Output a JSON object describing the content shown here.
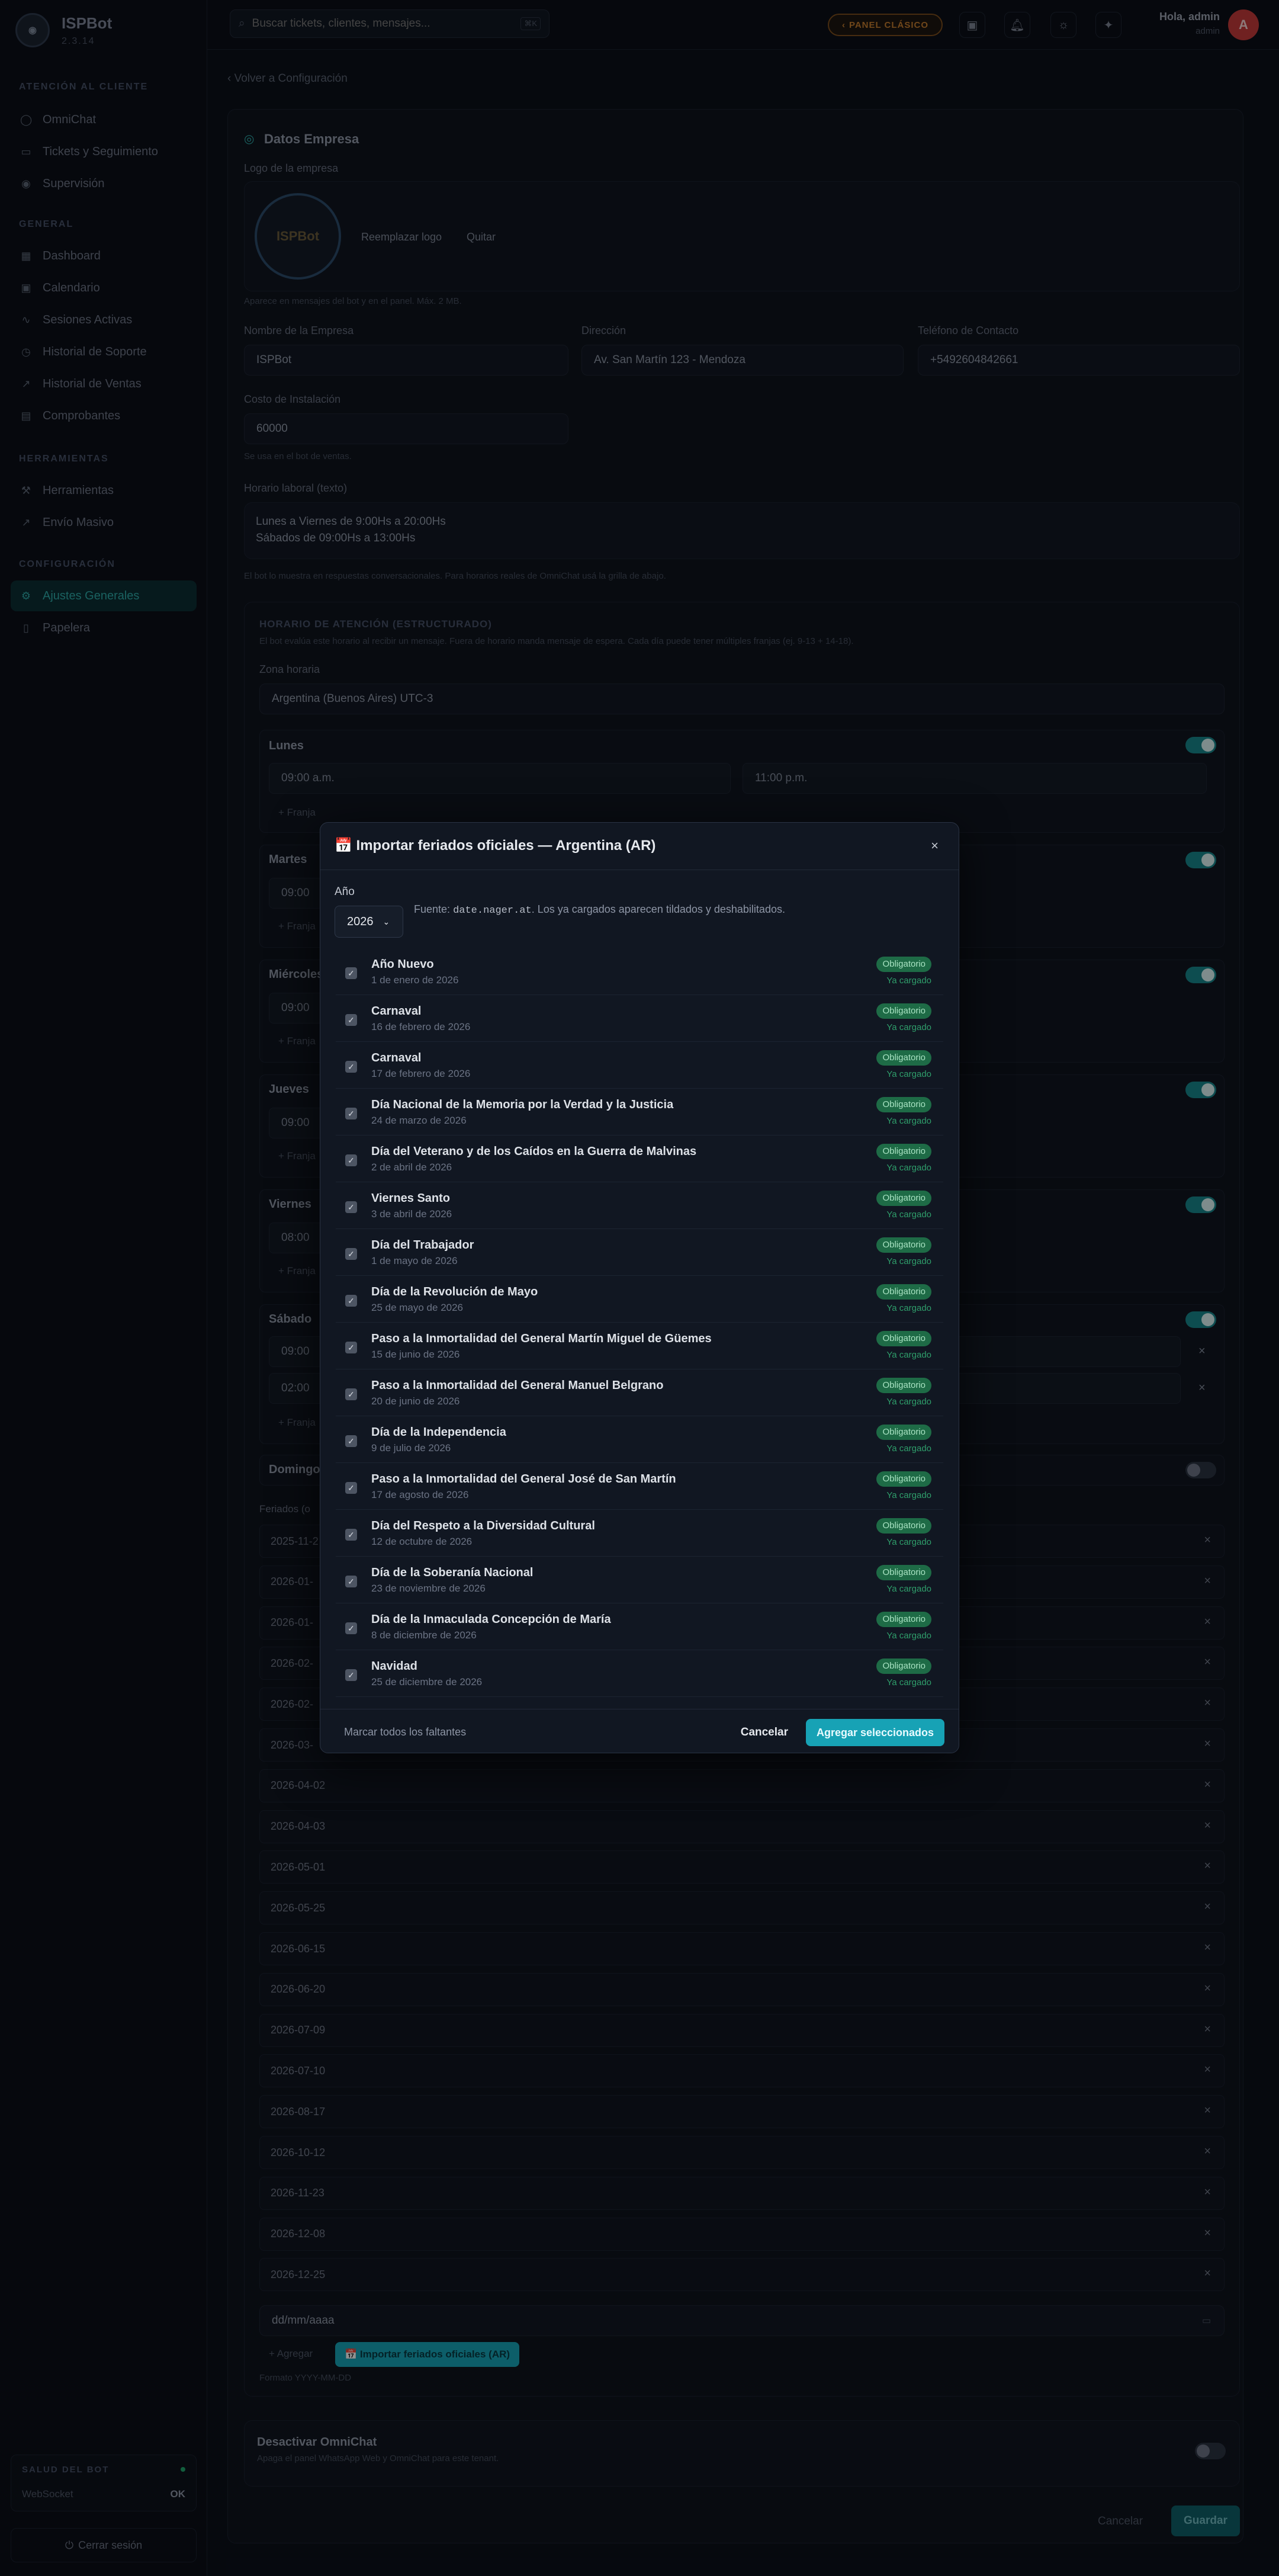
{
  "app": {
    "name": "ISPBot",
    "version": "2.3.14"
  },
  "sidebar": {
    "sections": [
      {
        "title": "ATENCIÓN AL CLIENTE",
        "items": [
          "OmniChat",
          "Tickets y Seguimiento",
          "Supervisión"
        ]
      },
      {
        "title": "GENERAL",
        "items": [
          "Dashboard",
          "Calendario",
          "Sesiones Activas",
          "Historial de Soporte",
          "Historial de Ventas",
          "Comprobantes"
        ]
      },
      {
        "title": "HERRAMIENTAS",
        "items": [
          "Herramientas",
          "Envío Masivo"
        ]
      },
      {
        "title": "CONFIGURACIÓN",
        "items": [
          "Ajustes Generales",
          "Papelera"
        ]
      }
    ],
    "health": {
      "title": "SALUD DEL BOT",
      "label": "WebSocket",
      "value": "OK"
    },
    "logout": "Cerrar sesión"
  },
  "topbar": {
    "search_placeholder": "Buscar tickets, clientes, mensajes...",
    "search_kbd": "⌘K",
    "panel_button": "PANEL CLÁSICO",
    "user_greeting": "Hola, admin",
    "user_role": "admin",
    "avatar_letter": "A"
  },
  "page": {
    "back": "‹ Volver a Configuración",
    "section_title": "Datos Empresa",
    "logo_label": "Logo de la empresa",
    "logo_text": "ISPBot",
    "replace_logo": "Reemplazar logo",
    "remove_logo": "Quitar",
    "logo_hint": "Aparece en mensajes del bot y en el panel. Máx. 2 MB.",
    "company_label": "Nombre de la Empresa",
    "company_value": "ISPBot",
    "address_label": "Dirección",
    "address_value": "Av. San Martín 123 - Mendoza",
    "phone_label": "Teléfono de Contacto",
    "phone_value": "+5492604842661",
    "install_label": "Costo de Instalación",
    "install_value": "60000",
    "install_hint": "Se usa en el bot de ventas.",
    "hours_label": "Horario laboral (texto)",
    "hours_line1": "Lunes a Viernes de 9:00Hs a 20:00Hs",
    "hours_line2": "Sábados de 09:00Hs a 13:00Hs",
    "hours_hint": "El bot lo muestra en respuestas conversacionales. Para horarios reales de OmniChat usá la grilla de abajo.",
    "structured_title": "HORARIO DE ATENCIÓN (ESTRUCTURADO)",
    "structured_hint": "El bot evalúa este horario al recibir un mensaje. Fuera de horario manda mensaje de espera. Cada día puede tener múltiples franjas (ej. 9-13 + 14-18).",
    "tz_label": "Zona horaria",
    "tz_value": "Argentina (Buenos Aires) UTC-3",
    "days": [
      {
        "name": "Lunes",
        "from": "09:00 a.m.",
        "to": "11:00 p.m."
      },
      {
        "name": "Martes",
        "from": "09:00"
      },
      {
        "name": "Miércoles",
        "from": "09:00"
      },
      {
        "name": "Jueves",
        "from": "09:00"
      },
      {
        "name": "Viernes",
        "from": "08:00"
      },
      {
        "name": "Sábado",
        "from": "09:00",
        "from2": "02:00"
      },
      {
        "name": "Domingo"
      }
    ],
    "add_franja": "+ Franja",
    "holidays_label": "Feriados (o",
    "holidays": [
      "2025-11-2",
      "2026-01-",
      "2026-01-",
      "2026-02-",
      "2026-02-",
      "2026-03-",
      "2026-04-02",
      "2026-04-03",
      "2026-05-01",
      "2026-05-25",
      "2026-06-15",
      "2026-06-20",
      "2026-07-09",
      "2026-07-10",
      "2026-08-17",
      "2026-10-12",
      "2026-11-23",
      "2026-12-08",
      "2026-12-25"
    ],
    "date_placeholder": "dd/mm/aaaa",
    "add_holiday": "+ Agregar",
    "import_button": "📅 Importar feriados oficiales (AR)",
    "format_hint": "Formato YYYY-MM-DD",
    "disable_title": "Desactivar OmniChat",
    "disable_hint": "Apaga el panel WhatsApp Web y OmniChat para este tenant.",
    "cancel": "Cancelar",
    "save": "Guardar"
  },
  "modal": {
    "title": "📅 Importar feriados oficiales — Argentina (AR)",
    "close": "×",
    "year_label": "Año",
    "year_value": "2026",
    "source_prefix": "Fuente:",
    "source_code": "date.nager.at",
    "source_suffix": ". Los ya cargados aparecen tildados y deshabilitados.",
    "badge": "Obligatorio",
    "loaded": "Ya cargado",
    "items": [
      {
        "name": "Año Nuevo",
        "date": "1 de enero de 2026"
      },
      {
        "name": "Carnaval",
        "date": "16 de febrero de 2026"
      },
      {
        "name": "Carnaval",
        "date": "17 de febrero de 2026"
      },
      {
        "name": "Día Nacional de la Memoria por la Verdad y la Justicia",
        "date": "24 de marzo de 2026"
      },
      {
        "name": "Día del Veterano y de los Caídos en la Guerra de Malvinas",
        "date": "2 de abril de 2026"
      },
      {
        "name": "Viernes Santo",
        "date": "3 de abril de 2026"
      },
      {
        "name": "Día del Trabajador",
        "date": "1 de mayo de 2026"
      },
      {
        "name": "Día de la Revolución de Mayo",
        "date": "25 de mayo de 2026"
      },
      {
        "name": "Paso a la Inmortalidad del General Martín Miguel de Güemes",
        "date": "15 de junio de 2026"
      },
      {
        "name": "Paso a la Inmortalidad del General Manuel Belgrano",
        "date": "20 de junio de 2026"
      },
      {
        "name": "Día de la Independencia",
        "date": "9 de julio de 2026"
      },
      {
        "name": "Paso a la Inmortalidad del General José de San Martín",
        "date": "17 de agosto de 2026"
      },
      {
        "name": "Día del Respeto a la Diversidad Cultural",
        "date": "12 de octubre de 2026"
      },
      {
        "name": "Día de la Soberanía Nacional",
        "date": "23 de noviembre de 2026"
      },
      {
        "name": "Día de la Inmaculada Concepción de María",
        "date": "8 de diciembre de 2026"
      },
      {
        "name": "Navidad",
        "date": "25 de diciembre de 2026"
      }
    ],
    "mark_all": "Marcar todos los faltantes",
    "cancel": "Cancelar",
    "add_selected": "Agregar seleccionados"
  }
}
